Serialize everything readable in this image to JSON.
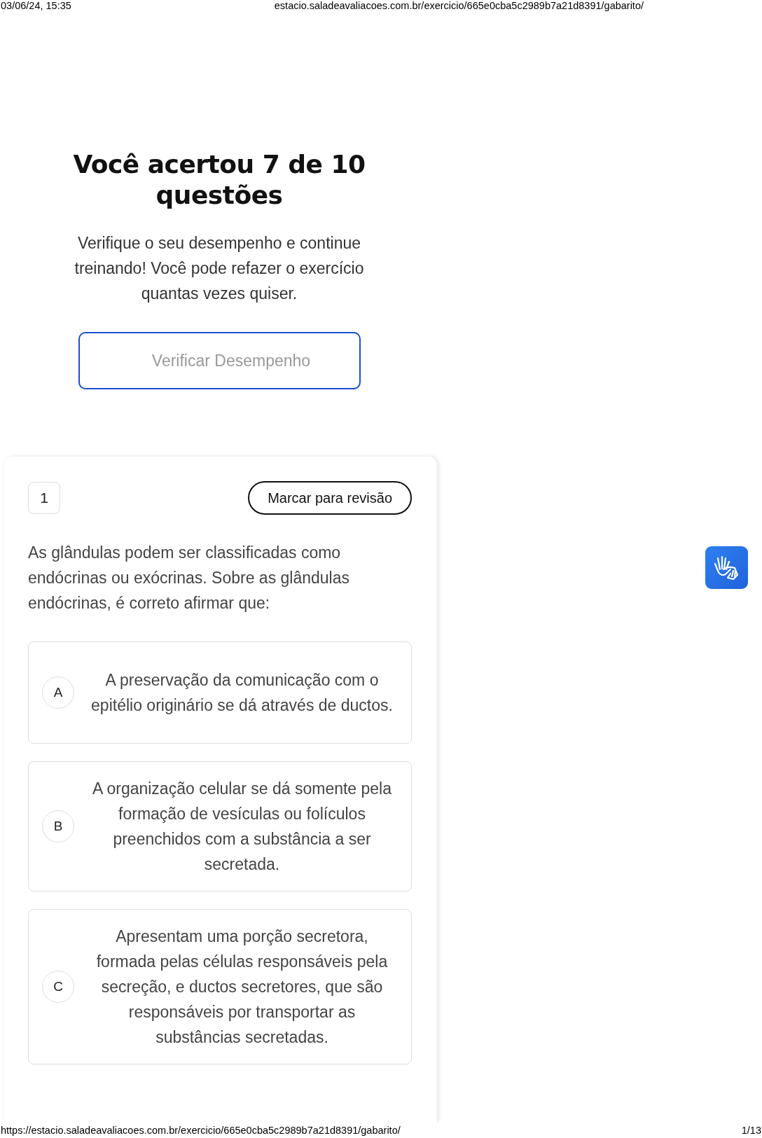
{
  "print_header": {
    "date": "03/06/24, 15:35",
    "url": "estacio.saladeavaliacoes.com.br/exercicio/665e0cba5c2989b7a21d8391/gabarito/"
  },
  "result": {
    "title": "Você acertou 7 de 10 questões",
    "message": "Verifique o seu desempenho e continue treinando! Você pode refazer o exercício quantas vezes quiser.",
    "button": "Verificar Desempenho"
  },
  "question": {
    "number": "1",
    "review_button": "Marcar para revisão",
    "text": "As glândulas podem ser classificadas como endócrinas ou exócrinas. Sobre as glândulas endócrinas, é correto afirmar que:",
    "options": [
      {
        "letter": "A",
        "text": "A preservação da comunicação com o epitélio originário se dá através de ductos."
      },
      {
        "letter": "B",
        "text": "A organização celular se dá somente pela formação de vesículas ou folículos preenchidos com a substância a ser secretada."
      },
      {
        "letter": "C",
        "text": "Apresentam uma porção secretora, formada pelas células responsáveis pela secreção, e ductos secretores, que são responsáveis por transportar as substâncias secretadas."
      }
    ]
  },
  "print_footer": {
    "url": "https://estacio.saladeavaliacoes.com.br/exercicio/665e0cba5c2989b7a21d8391/gabarito/",
    "page": "1/13"
  }
}
